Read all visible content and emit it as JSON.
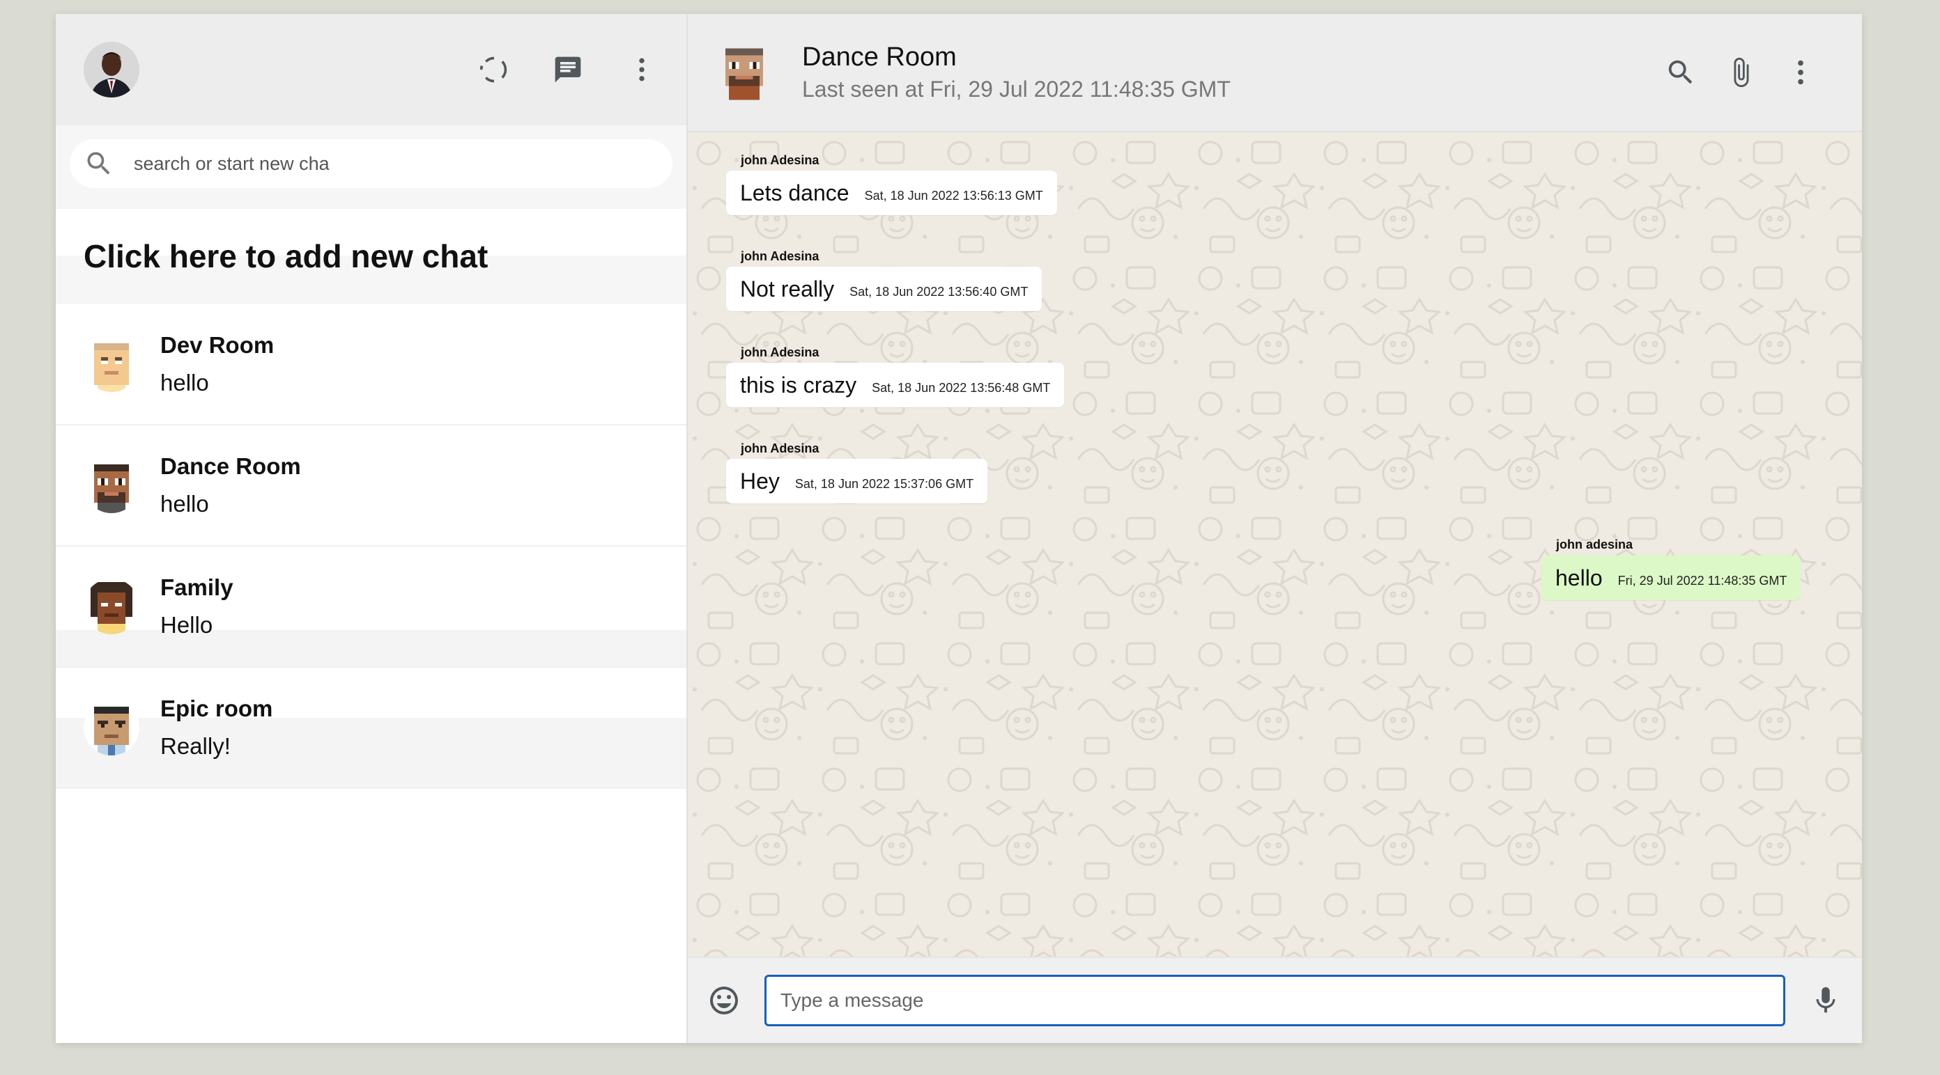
{
  "sidebar": {
    "search": {
      "placeholder": "search or start new cha"
    },
    "add_chat_label": "Click here to add new chat",
    "chats": [
      {
        "name": "Dev Room",
        "last_message": "hello"
      },
      {
        "name": "Dance Room",
        "last_message": "hello"
      },
      {
        "name": "Family",
        "last_message": "Hello"
      },
      {
        "name": "Epic room",
        "last_message": "Really!"
      }
    ]
  },
  "header": {
    "title": "Dance Room",
    "last_seen": "Last seen at Fri, 29 Jul 2022 11:48:35 GMT"
  },
  "messages": [
    {
      "sender": "john Adesina",
      "text": "Lets dance",
      "time": "Sat, 18 Jun 2022 13:56:13 GMT",
      "mine": false
    },
    {
      "sender": "john Adesina",
      "text": "Not really",
      "time": "Sat, 18 Jun 2022 13:56:40 GMT",
      "mine": false
    },
    {
      "sender": "john Adesina",
      "text": "this is crazy",
      "time": "Sat, 18 Jun 2022 13:56:48 GMT",
      "mine": false
    },
    {
      "sender": "john Adesina",
      "text": "Hey",
      "time": "Sat, 18 Jun 2022 15:37:06 GMT",
      "mine": false
    },
    {
      "sender": "john adesina",
      "text": "hello",
      "time": "Fri, 29 Jul 2022 11:48:35 GMT",
      "mine": true
    }
  ],
  "footer": {
    "placeholder": "Type a message"
  },
  "icons": {
    "status": "status-icon",
    "new_chat": "chat-icon",
    "menu": "more-vert-icon",
    "search": "search-icon",
    "attach": "attach-icon",
    "emoji": "emoji-icon",
    "mic": "mic-icon"
  },
  "colors": {
    "header_bg": "#ededed",
    "chat_bg": "#efeae2",
    "own_bubble": "#dcf8c6",
    "input_border": "#1560bd"
  }
}
